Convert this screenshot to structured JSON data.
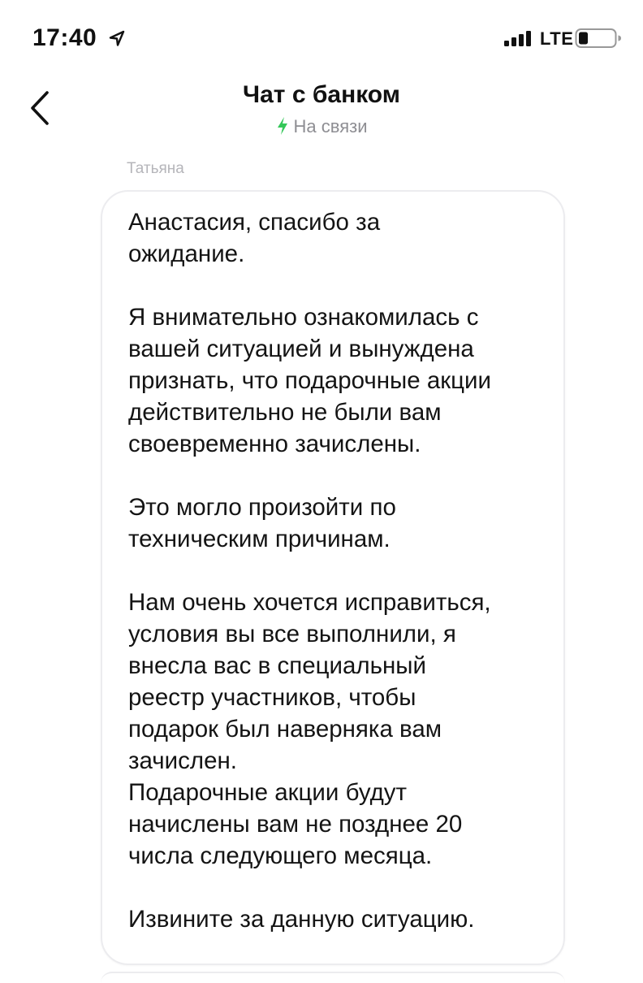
{
  "status_bar": {
    "time": "17:40",
    "network": "LTE",
    "icons": [
      "location-arrow-icon",
      "signal-bars-icon",
      "battery-icon"
    ]
  },
  "header": {
    "back_icon": "chevron-left-icon",
    "title": "Чат с банком",
    "status_icon": "lightning-bolt-icon",
    "status": "На связи"
  },
  "chat": {
    "messages": [
      {
        "sender": "Татьяна",
        "text": "Анастасия, спасибо за\nожидание.\n\nЯ внимательно ознакомилась с\nвашей ситуацией и вынуждена\nпризнать, что подарочные акции\nдействительно не были вам\nсвоевременно зачислены.\n\nЭто могло произойти по\nтехническим причинам.\n\nНам очень хочется исправиться,\nусловия вы все выполнили, я\nвнесла вас в специальный\nреестр участников, чтобы\nподарок был наверняка вам\nзачислен.\nПодарочные акции будут\nначислены вам не позднее 20\nчисла следующего месяца.\n\nИзвините за данную ситуацию."
      }
    ]
  },
  "colors": {
    "accent_green": "#34c759",
    "secondary_text": "#8e8e93",
    "sender_text": "#b5b5ba",
    "bubble_border": "#ececef"
  }
}
